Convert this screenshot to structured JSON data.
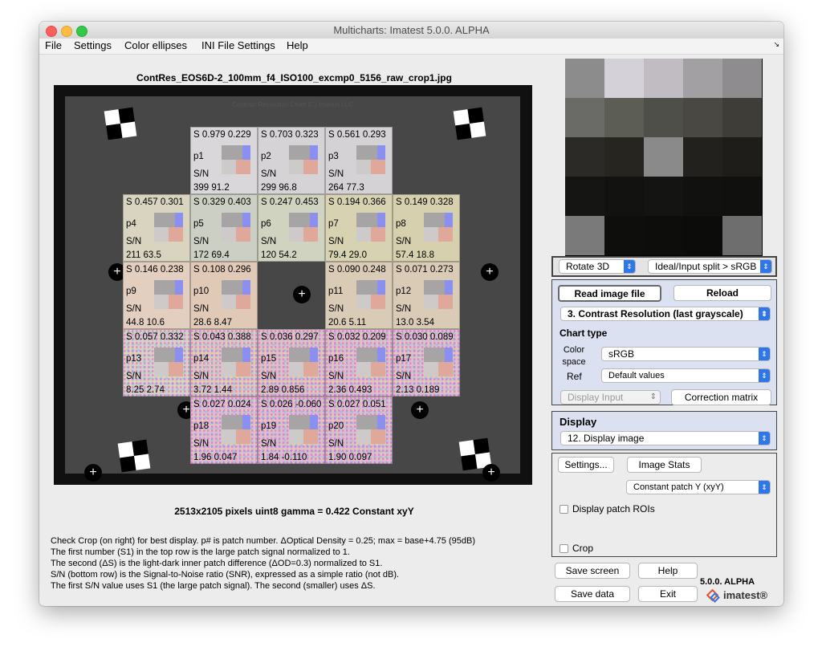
{
  "window": {
    "title": "Multicharts:  Imatest 5.0.0. ALPHA"
  },
  "menu": [
    "File",
    "Settings",
    "Color ellipses",
    "INI File Settings",
    "Help"
  ],
  "image_title": "ContRes_EOS6D-2_100mm_f4_ISO100_excmp0_5156_raw_crop1.jpg",
  "chart_header": "Contrast Resolution Chart (C) Imatest LLC",
  "patches": [
    {
      "label": "p1",
      "s": "S 0.979 0.229",
      "sn": "S/N",
      "snv": "399  91.2"
    },
    {
      "label": "p2",
      "s": "S 0.703 0.323",
      "sn": "S/N",
      "snv": "299  96.8"
    },
    {
      "label": "p3",
      "s": "S 0.561 0.293",
      "sn": "S/N",
      "snv": "264  77.3"
    },
    {
      "label": "p4",
      "s": "S 0.457 0.301",
      "sn": "S/N",
      "snv": "211  63.5"
    },
    {
      "label": "p5",
      "s": "S 0.329 0.403",
      "sn": "S/N",
      "snv": "172  69.4"
    },
    {
      "label": "p6",
      "s": "S 0.247 0.453",
      "sn": "S/N",
      "snv": "120  54.2"
    },
    {
      "label": "p7",
      "s": "S 0.194 0.366",
      "sn": "S/N",
      "snv": "79.4  29.0"
    },
    {
      "label": "p8",
      "s": "S 0.149 0.328",
      "sn": "S/N",
      "snv": "57.4  18.8"
    },
    {
      "label": "p9",
      "s": "S 0.146 0.238",
      "sn": "S/N",
      "snv": "44.8  10.6"
    },
    {
      "label": "p10",
      "s": "S 0.108 0.296",
      "sn": "S/N",
      "snv": "28.6  8.47"
    },
    {
      "label": "p11",
      "s": "S 0.090 0.248",
      "sn": "S/N",
      "snv": "20.6  5.11"
    },
    {
      "label": "p12",
      "s": "S 0.071 0.273",
      "sn": "S/N",
      "snv": "13.0  3.54"
    },
    {
      "label": "p13",
      "s": "S 0.057 0.332",
      "sn": "S/N",
      "snv": "8.25  2.74"
    },
    {
      "label": "p14",
      "s": "S 0.043 0.388",
      "sn": "S/N",
      "snv": "3.72  1.44"
    },
    {
      "label": "p15",
      "s": "S 0.036 0.297",
      "sn": "S/N",
      "snv": "2.89  0.856"
    },
    {
      "label": "p16",
      "s": "S 0.032 0.209",
      "sn": "S/N",
      "snv": "2.36  0.493"
    },
    {
      "label": "p17",
      "s": "S 0.030 0.089",
      "sn": "S/N",
      "snv": "2.13  0.189"
    },
    {
      "label": "p18",
      "s": "S 0.027 0.024",
      "sn": "S/N",
      "snv": "1.96  0.047"
    },
    {
      "label": "p19",
      "s": "S 0.026 -0.060",
      "sn": "S/N",
      "snv": "1.84  -0.110"
    },
    {
      "label": "p20",
      "s": "S 0.027 0.051",
      "sn": "S/N",
      "snv": "1.90  0.097"
    }
  ],
  "image_info": "2513x2105 pixels    uint8    gamma = 0.422    Constant xyY",
  "notes": [
    "Check Crop (on right) for best display. p# is patch number. ΔOptical Density = 0.25; max = base+4.75 (95dB)",
    "The first number (S1) in the top row is the large patch signal normalized to 1.",
    "The second (ΔS) is the light-dark inner patch difference (ΔOD=0.3) normalized to S1.",
    "S/N (bottom row) is the Signal-to-Noise ratio (SNR), expressed as a simple ratio (not dB).",
    "The first S/N value uses S1 (the large patch signal). The second (smaller) uses ΔS."
  ],
  "thumb_colors": [
    [
      "#8c8c8c",
      "#d4d2d8",
      "#c0bcc2",
      "#a2a0a3",
      "#8e8c8e"
    ],
    [
      "#6a6a66",
      "#5c5d55",
      "#4f4f49",
      "#494842",
      "#3e3d37"
    ],
    [
      "#2b2a26",
      "#262520",
      "#8a8a8a",
      "#22211d",
      "#1e1d1a"
    ],
    [
      "#151513",
      "#121211",
      "#141413",
      "#111110",
      "#10100f"
    ],
    [
      "#7a7a7a",
      "#0e0e0d",
      "#0d0d0c",
      "#0c0c0b",
      "#6e6e6e"
    ]
  ],
  "top_controls": {
    "rotate": "Rotate 3D",
    "split": "Ideal/Input split > sRGB"
  },
  "read_panel": {
    "read_button": "Read image file",
    "reload_button": "Reload",
    "chart_select": "3.  Contrast Resolution  (last grayscale)",
    "chart_type_label": "Chart type",
    "color_space_label": "Color space",
    "color_space_value": "sRGB",
    "ref_label": "Ref",
    "ref_value": "Default values",
    "display_input": "Display Input",
    "correction_button": "Correction matrix"
  },
  "display_panel": {
    "title": "Display",
    "select": "12. Display image"
  },
  "settings_panel": {
    "settings_button": "Settings...",
    "image_stats_button": "Image Stats",
    "patch_select": "Constant patch Y (xyY)",
    "roi_checkbox": "Display patch ROIs",
    "crop_checkbox": "Crop"
  },
  "bottom_buttons": {
    "save_screen": "Save screen",
    "help": "Help",
    "save_data": "Save data",
    "exit": "Exit"
  },
  "version": "5.0.0. ALPHA",
  "brand": "imatest®",
  "accent": "#2f76e8"
}
